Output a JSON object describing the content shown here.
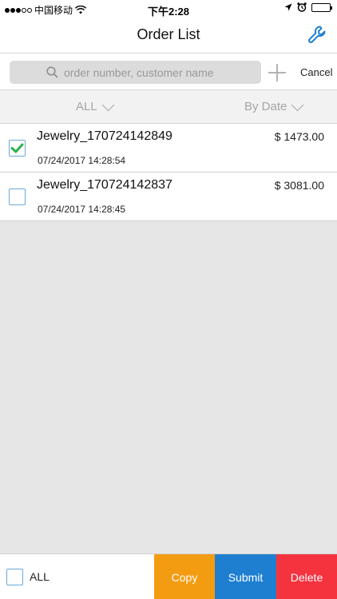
{
  "status_bar": {
    "carrier": "中国移动",
    "time": "下午2:28"
  },
  "nav": {
    "title": "Order List",
    "settings_icon": "wrench-icon"
  },
  "search": {
    "placeholder": "order number, customer name",
    "value": "",
    "add_icon": "plus-icon",
    "cancel_label": "Cancel"
  },
  "filters": {
    "status": "ALL",
    "sort": "By Date"
  },
  "orders": [
    {
      "name": "Jewelry_170724142849",
      "date": "07/24/2017 14:28:54",
      "amount": "$ 1473.00",
      "checked": true
    },
    {
      "name": "Jewelry_170724142837",
      "date": "07/24/2017 14:28:45",
      "amount": "$ 3081.00",
      "checked": false
    }
  ],
  "bottom_bar": {
    "select_all_label": "ALL",
    "copy_label": "Copy",
    "submit_label": "Submit",
    "delete_label": "Delete"
  },
  "colors": {
    "accent_blue": "#1e7fd0",
    "copy_orange": "#f39c12",
    "delete_red": "#f5333f",
    "check_green": "#2bb24c"
  }
}
